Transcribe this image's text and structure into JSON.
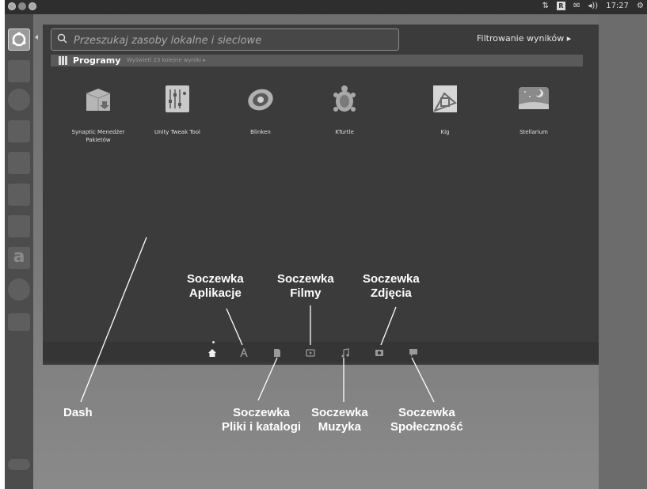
{
  "topbar": {
    "indicators": [
      "⇅",
      "R",
      "✉",
      "◂))"
    ],
    "time": "17:27"
  },
  "search": {
    "placeholder": "Przeszukaj zasoby lokalne i sieciowe"
  },
  "filter_label": "Filtrowanie wyników ▸",
  "category": {
    "title": "Programy",
    "more_results": "Wyświetl 23 kolejne wyniki ▸"
  },
  "apps": [
    {
      "label": "Synaptic Menedżer Pakietów",
      "icon": "package-icon"
    },
    {
      "label": "Unity Tweak Tool",
      "icon": "tweak-icon"
    },
    {
      "label": "Blinken",
      "icon": "blinken-icon"
    },
    {
      "label": "KTurtle",
      "icon": "turtle-icon"
    },
    {
      "label": "Kig",
      "icon": "kig-icon"
    },
    {
      "label": "Stellarium",
      "icon": "stellarium-icon"
    }
  ],
  "lenses": [
    "home-lens",
    "applications-lens",
    "files-lens",
    "video-lens",
    "music-lens",
    "photo-lens",
    "social-lens"
  ],
  "callouts": {
    "dash": "Dash",
    "apps_line1": "Soczewka",
    "apps_line2": "Aplikacje",
    "video_line1": "Soczewka",
    "video_line2": "Filmy",
    "photo_line1": "Soczewka",
    "photo_line2": "Zdjęcia",
    "files_line1": "Soczewka",
    "files_line2": "Pliki i katalogi",
    "music_line1": "Soczewka",
    "music_line2": "Muzyka",
    "social_line1": "Soczewka",
    "social_line2": "Społeczność"
  },
  "launcher_letter": "a"
}
